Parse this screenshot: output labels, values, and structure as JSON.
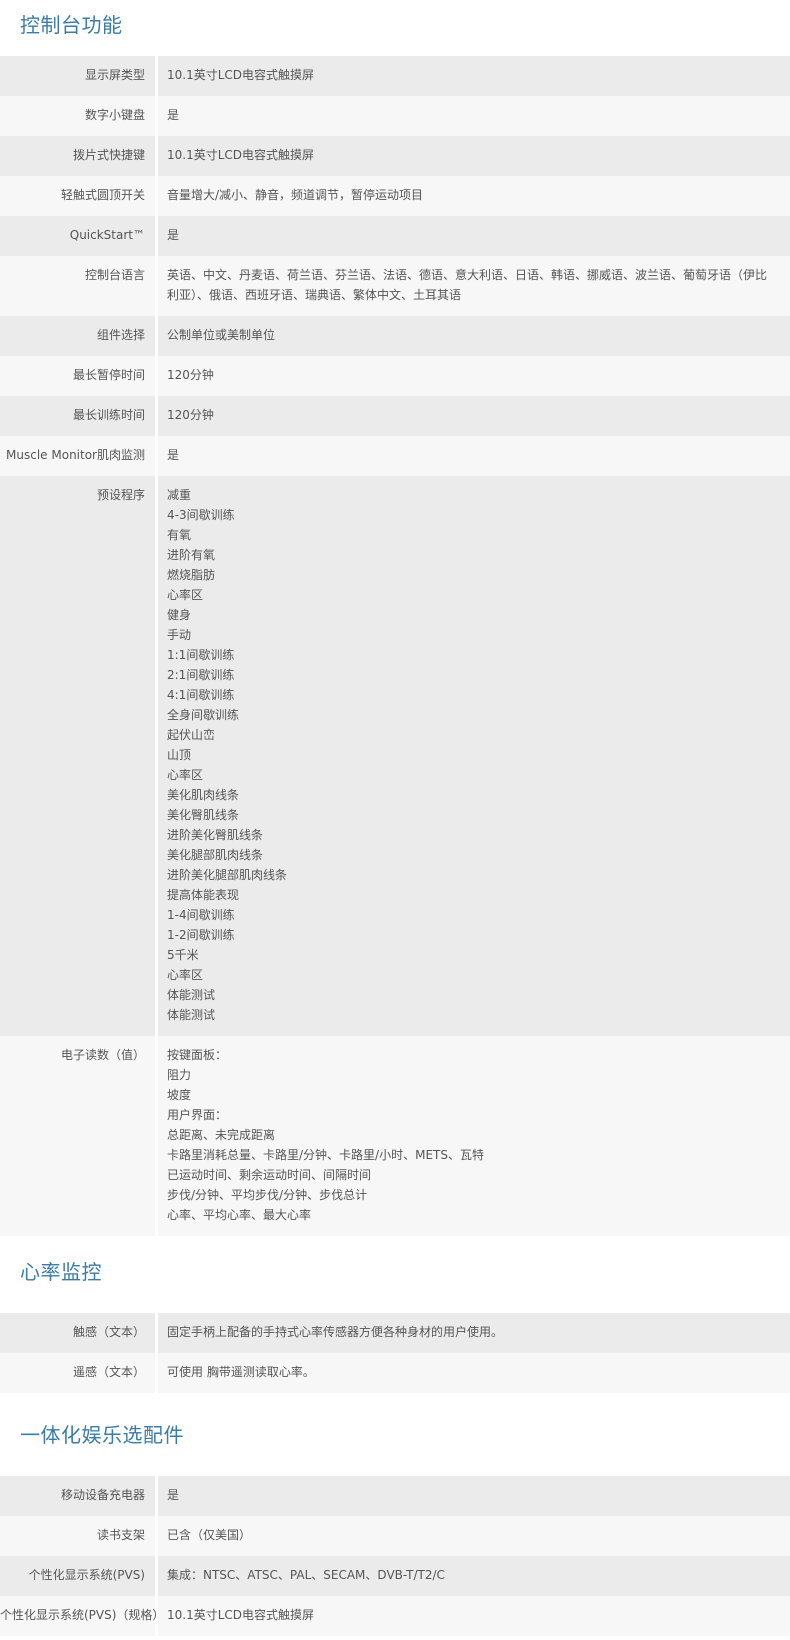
{
  "sections": [
    {
      "title": "控制台功能",
      "rows": [
        {
          "label": "显示屏类型",
          "lines": [
            "10.1英寸LCD电容式触摸屏"
          ]
        },
        {
          "label": "数字小键盘",
          "lines": [
            "是"
          ]
        },
        {
          "label": "拨片式快捷键",
          "lines": [
            "10.1英寸LCD电容式触摸屏"
          ]
        },
        {
          "label": "轻触式圆顶开关",
          "lines": [
            "音量增大/减小、静音，频道调节，暂停运动项目"
          ]
        },
        {
          "label": "QuickStart™",
          "lines": [
            "是"
          ]
        },
        {
          "label": "控制台语言",
          "lines": [
            "英语、中文、丹麦语、荷兰语、芬兰语、法语、德语、意大利语、日语、韩语、挪威语、波兰语、葡萄牙语（伊比利亚）、俄语、西班牙语、瑞典语、繁体中文、土耳其语"
          ]
        },
        {
          "label": "组件选择",
          "lines": [
            "公制单位或美制单位"
          ]
        },
        {
          "label": "最长暂停时间",
          "lines": [
            "120分钟"
          ]
        },
        {
          "label": "最长训练时间",
          "lines": [
            "120分钟"
          ]
        },
        {
          "label": "Muscle Monitor肌肉监测",
          "lines": [
            "是"
          ]
        },
        {
          "label": "预设程序",
          "lines": [
            "减重",
            "4-3间歇训练",
            "有氧",
            "进阶有氧",
            "燃烧脂肪",
            "心率区",
            "健身",
            "手动",
            "1:1间歇训练",
            "2:1间歇训练",
            "4:1间歇训练",
            "全身间歇训练",
            "起伏山峦",
            "山顶",
            "心率区",
            "美化肌肉线条",
            "美化臀肌线条",
            "进阶美化臀肌线条",
            "美化腿部肌肉线条",
            "进阶美化腿部肌肉线条",
            "提高体能表现",
            "1-4间歇训练",
            "1-2间歇训练",
            "5千米",
            "心率区",
            "体能测试",
            "体能测试"
          ]
        },
        {
          "label": "电子读数（值）",
          "lines": [
            "按键面板：",
            "阻力",
            "坡度",
            "用户界面：",
            "总距离、未完成距离",
            "卡路里消耗总量、卡路里/分钟、卡路里/小时、METS、瓦特",
            "已运动时间、剩余运动时间、间隔时间",
            "步伐/分钟、平均步伐/分钟、步伐总计",
            "心率、平均心率、最大心率"
          ]
        }
      ]
    },
    {
      "title": "心率监控",
      "rows": [
        {
          "label": "触感（文本）",
          "lines": [
            "固定手柄上配备的手持式心率传感器方便各种身材的用户使用。"
          ]
        },
        {
          "label": "遥感（文本）",
          "lines": [
            "可使用 胸带遥测读取心率。"
          ]
        }
      ]
    },
    {
      "title": "一体化娱乐选配件",
      "rows": [
        {
          "label": "移动设备充电器",
          "lines": [
            "是"
          ]
        },
        {
          "label": "读书支架",
          "lines": [
            "已含（仅美国）"
          ]
        },
        {
          "label": "个性化显示系统(PVS)",
          "lines": [
            "集成：NTSC、ATSC、PAL、SECAM、DVB-T/T2/C"
          ]
        },
        {
          "label": "个性化显示系统(PVS)（规格）",
          "lines": [
            "10.1英寸LCD电容式触摸屏"
          ]
        }
      ]
    }
  ]
}
